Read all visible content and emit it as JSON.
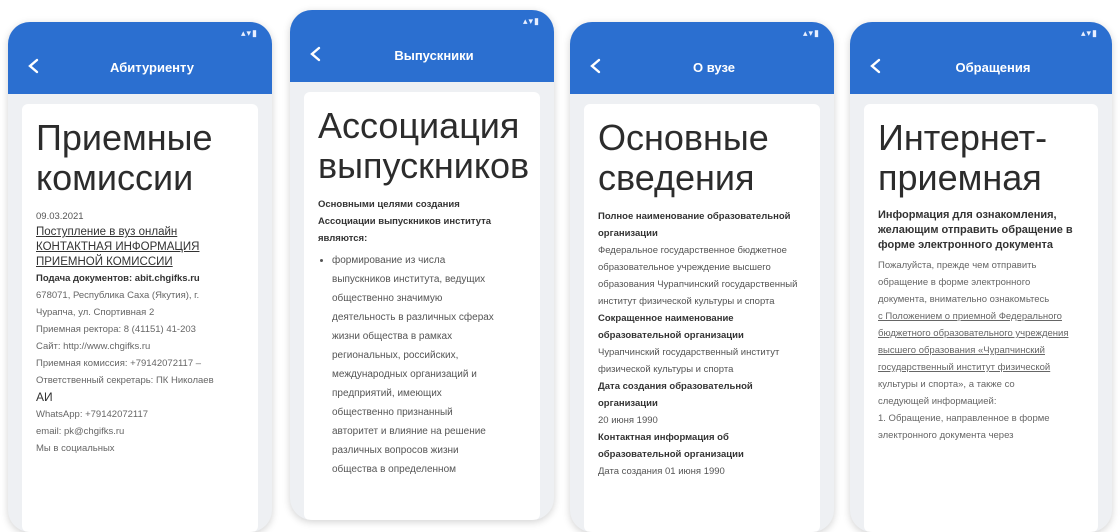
{
  "screens": [
    {
      "title": "Абитуриенту",
      "heading": "Приемные комиссии",
      "date": "09.03.2021",
      "links": [
        "Поступление в вуз онлайн",
        "КОНТАКТНАЯ ИНФОРМАЦИЯ",
        "ПРИЕМНОЙ КОМИССИИ"
      ],
      "docs_line": "Подача документов: abit.chgifks.ru",
      "rows": [
        "678071, Республика Саха (Якутия), г.",
        "Чурапча, ул. Спортивная 2",
        "Приемная ректора: 8 (41151) 41-203",
        "Сайт: http://www.chgifks.ru",
        "Приемная комиссия: +79142072117 –",
        "Ответственный секретарь: ПК Николаев",
        "АИ",
        "WhatsApp: +79142072117",
        "email: pk@chgifks.ru",
        "Мы в социальных"
      ]
    },
    {
      "title": "Выпускники",
      "heading": "Ассоциация выпускников",
      "intro": [
        "Основными целями создания",
        "Ассоциации выпускников института",
        "являются:"
      ],
      "bullets": [
        "формирование из числа",
        "выпускников института, ведущих",
        "общественно значимую",
        "деятельность в различных сферах",
        "жизни общества в рамках",
        "региональных, российских,",
        "международных организаций и",
        "предприятий, имеющих",
        "общественно признанный",
        "авторитет и влияние на решение",
        "различных вопросов жизни",
        "общества в определенном"
      ]
    },
    {
      "title": "О вузе",
      "heading": "Основные сведения",
      "sections": [
        {
          "label": "Полное наименование образовательной организации",
          "text": "Федеральное государственное бюджетное образовательное учреждение высшего образования Чурапчинский государственный институт физической культуры и спорта"
        },
        {
          "label": "Сокращенное наименование образовательной организации",
          "text": "Чурапчинский государственный институт физической культуры и спорта"
        },
        {
          "label": "Дата создания образовательной организации",
          "text": "20 июня 1990"
        },
        {
          "label": "Контактная информация об образовательной организации",
          "text": "Дата создания 01 июня 1990"
        }
      ]
    },
    {
      "title": "Обращения",
      "heading": "Интернет-приемная",
      "intro": "Информация для ознакомления, желающим отправить обращение в форме электронного документа",
      "rows": [
        "Пожалуйста, прежде чем отправить",
        "обращение в форме электронного",
        "документа, внимательно ознакомьтесь",
        "с Положением о приемной Федерального",
        "бюджетного образовательного учреждения",
        "высшего образования «Чурапчинский",
        "государственный институт физической",
        "культуры и спорта», а также со",
        "следующей информацией:",
        "1. Обращение, направленное в форме",
        "электронного документа через"
      ]
    }
  ]
}
